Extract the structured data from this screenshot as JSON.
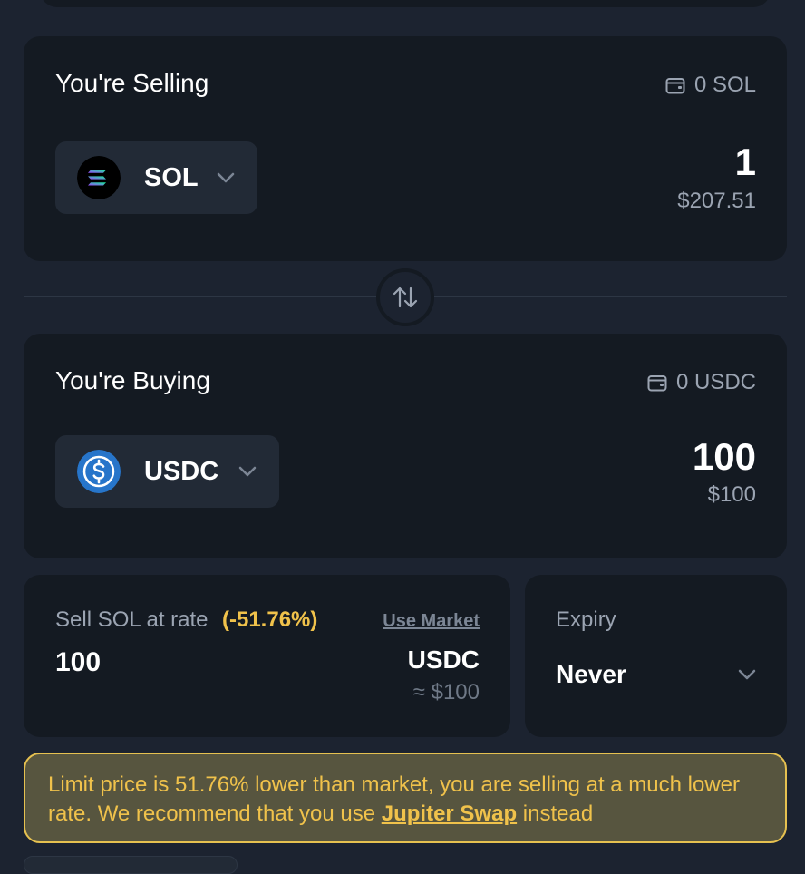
{
  "sell": {
    "title": "You're Selling",
    "balance": "0 SOL",
    "token": "SOL",
    "amount": "1",
    "usd_value": "$207.51"
  },
  "buy": {
    "title": "You're Buying",
    "balance": "0 USDC",
    "token": "USDC",
    "amount": "100",
    "usd_value": "$100"
  },
  "rate": {
    "label": "Sell SOL at rate",
    "difference": "(-51.76%)",
    "use_market_label": "Use Market",
    "value": "100",
    "unit": "USDC",
    "usd_equiv": "≈ $100"
  },
  "expiry": {
    "label": "Expiry",
    "value": "Never"
  },
  "warning": {
    "text_before": "Limit price is 51.76% lower than market, you are selling at a much lower rate. We recommend that you use ",
    "link": "Jupiter Swap",
    "text_after": " instead"
  },
  "colors": {
    "background": "#1c2330",
    "panel": "#141a22",
    "warning": "#f0c24b",
    "warning_bg": "#57553f"
  },
  "icons": {
    "wallet": "wallet-icon",
    "chevron": "chevron-down-icon",
    "swap": "swap-arrows-icon",
    "sol": "solana-logo",
    "usdc": "usdc-logo"
  }
}
